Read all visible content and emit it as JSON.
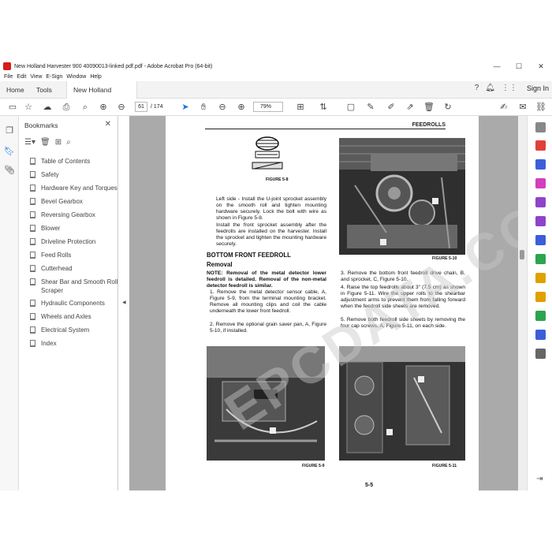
{
  "window": {
    "title": "New Holland Harvester 900 40090013-linked pdf.pdf - Adobe Acrobat Pro (64-bit)",
    "minimize": "—",
    "maximize": "☐",
    "close": "✕"
  },
  "menu": [
    "File",
    "Edit",
    "View",
    "E-Sign",
    "Window",
    "Help"
  ],
  "tabs": {
    "home": "Home",
    "tools": "Tools",
    "document": "New Holland Harve...",
    "close": "✕",
    "sign_in": "Sign In"
  },
  "toolbar": {
    "current_page": "61",
    "total_pages": "/ 174",
    "zoom": "79%"
  },
  "bookmarks": {
    "title": "Bookmarks",
    "items": [
      "Table of Contents",
      "Safety",
      "Hardware Key and Torques",
      "Bevel Gearbox",
      "Reversing Gearbox",
      "Blower",
      "Driveline Protection",
      "Feed Rolls",
      "Cutterhead",
      "Shear Bar and Smooth Roll Scraper",
      "Hydraulic Components",
      "Wheels and Axles",
      "Electrical System",
      "Index"
    ]
  },
  "document": {
    "header": "FEEDROLLS",
    "fig8": "FIGURE 5-8",
    "left_side_text": "Left side - Install the U-joint sprocket assembly on the smooth roll and tighten mounting hardware securely. Lock the bolt with wire as shown in Figure 5-8.",
    "front_sprocket_text": "Install the front sprocket assembly after the feedrolls are installed on the harvester. Install the sprocket and tighten the mounting hardware securely.",
    "section_title": "BOTTOM FRONT FEEDROLL",
    "subsection_title": "Removal",
    "note": "NOTE: Removal of the metal detector lower feedroll is detailed. Removal of the non-metal detector feedroll is similar.",
    "step1": "1.  Remove the metal detector sensor cable, A, Figure 5-9, from the terminal mounting bracket. Remove all mounting clips and coil the cable underneath the lower front feedroll.",
    "step2": "2.  Remove the optional grain saver pan, A, Figure 5-10, if installed.",
    "step3": "3.  Remove the bottom front feedroll drive chain, B, and sprocket, C, Figure 5-10.",
    "step4": "4.  Raise the top feedrolls about 3\" (7.5 cm) as shown in Figure 5-11. Wire the upper rolls to the shearbar adjustment arms to prevent them from falling forward when the feedroll side sheets are removed.",
    "step5": "5.  Remove both feedroll side sheets by removing the four cap screws, A, Figure 5-11, on each side.",
    "fig9": "FIGURE 5-9",
    "fig10": "FIGURE 5-10",
    "fig11": "FIGURE 5-11",
    "page_number": "5-5",
    "watermark": "EPCDATA.COM"
  },
  "colors": {
    "accent": "#1473e6",
    "acrobat_red": "#d71b1b",
    "doc_background": "#aaaaaa"
  }
}
